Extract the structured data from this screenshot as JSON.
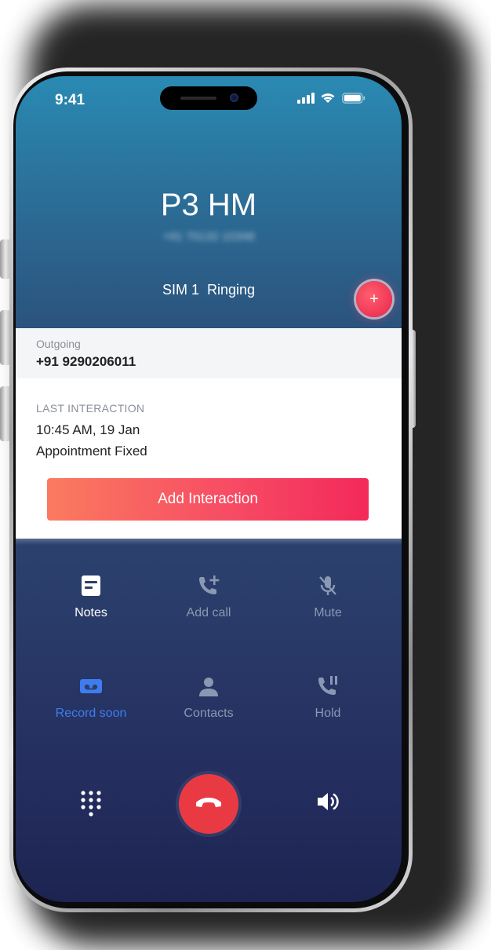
{
  "status_bar": {
    "time": "9:41",
    "signal_icon": "cellular-signal-icon",
    "wifi_icon": "wifi-icon",
    "battery_icon": "battery-icon"
  },
  "call": {
    "caller_name": "P3 HM",
    "caller_number_masked": "+91 70132 10348",
    "sim_status": "SIM 1  Ringing",
    "fab_icon": "plus-icon",
    "fab_label": "+"
  },
  "info_panel": {
    "outgoing_label": "Outgoing",
    "outgoing_number": "+91 9290206011",
    "last_interaction_label": "LAST INTERACTION",
    "last_interaction_time": "10:45 AM, 19 Jan",
    "last_interaction_note": "Appointment Fixed",
    "add_interaction_label": "Add Interaction"
  },
  "controls": {
    "notes": {
      "label": "Notes",
      "icon": "notes-icon",
      "state": "active"
    },
    "add_call": {
      "label": "Add call",
      "icon": "add-call-icon",
      "state": "disabled"
    },
    "mute": {
      "label": "Mute",
      "icon": "mute-icon",
      "state": "disabled"
    },
    "record": {
      "label": "Record soon",
      "icon": "record-icon",
      "state": "accent"
    },
    "contacts": {
      "label": "Contacts",
      "icon": "contacts-icon",
      "state": "disabled"
    },
    "hold": {
      "label": "Hold",
      "icon": "hold-icon",
      "state": "disabled"
    }
  },
  "bottom_bar": {
    "keypad_icon": "keypad-icon",
    "end_call_icon": "end-call-icon",
    "speaker_icon": "speaker-icon"
  },
  "colors": {
    "accent_red": "#e93a44",
    "accent_blue": "#3f7cf0",
    "button_gradient_start": "#fa7b5f",
    "button_gradient_end": "#f3295a"
  }
}
